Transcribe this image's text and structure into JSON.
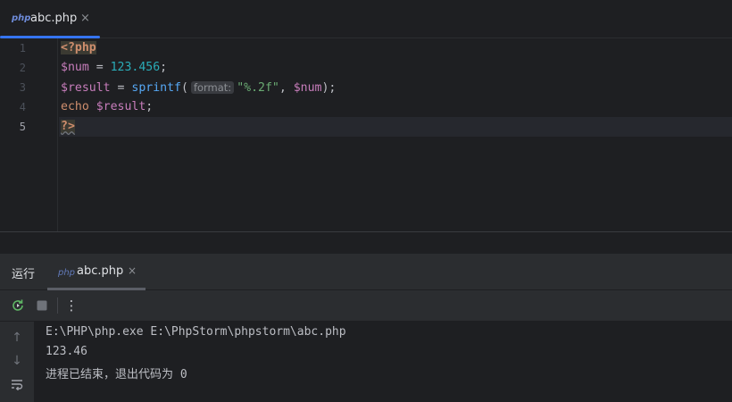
{
  "editor_tab": {
    "icon": "php-file-icon",
    "logo_text": "php",
    "label": "abc.php",
    "close": "×"
  },
  "editor": {
    "line_numbers": [
      "1",
      "2",
      "3",
      "4",
      "5"
    ],
    "current_line": 5,
    "lines": {
      "l1": {
        "open_tag": "<?php"
      },
      "l2": {
        "var": "$num",
        "op": " = ",
        "num": "123.456",
        "end": ";"
      },
      "l3": {
        "var": "$result",
        "op": " = ",
        "fn": "sprintf",
        "paren_open": "(",
        "hint": "format:",
        "str": "\"%.2f\"",
        "comma": ", ",
        "arg_var": "$num",
        "end": ");"
      },
      "l4": {
        "kw": "echo",
        "space": " ",
        "var": "$result",
        "end": ";"
      },
      "l5": {
        "close_tag": "?>"
      }
    }
  },
  "run_window": {
    "title": "运行",
    "tab": {
      "icon": "php-file-icon",
      "logo_text": "php",
      "label": "abc.php",
      "close": "×"
    },
    "toolbar": {
      "rerun": "rerun-icon",
      "stop": "stop-icon",
      "more": "more-vertical-icon",
      "more_glyph": "⋮"
    },
    "side": {
      "up": "↑",
      "down": "↓",
      "wrap": "soft-wrap-icon"
    },
    "console": [
      "E:\\PHP\\php.exe E:\\PhpStorm\\phpstorm\\abc.php",
      "123.46",
      "进程已结束，退出代码为 0"
    ]
  },
  "colors": {
    "accent": "#3574f0",
    "background": "#1e1f22",
    "panel": "#2b2d30"
  }
}
